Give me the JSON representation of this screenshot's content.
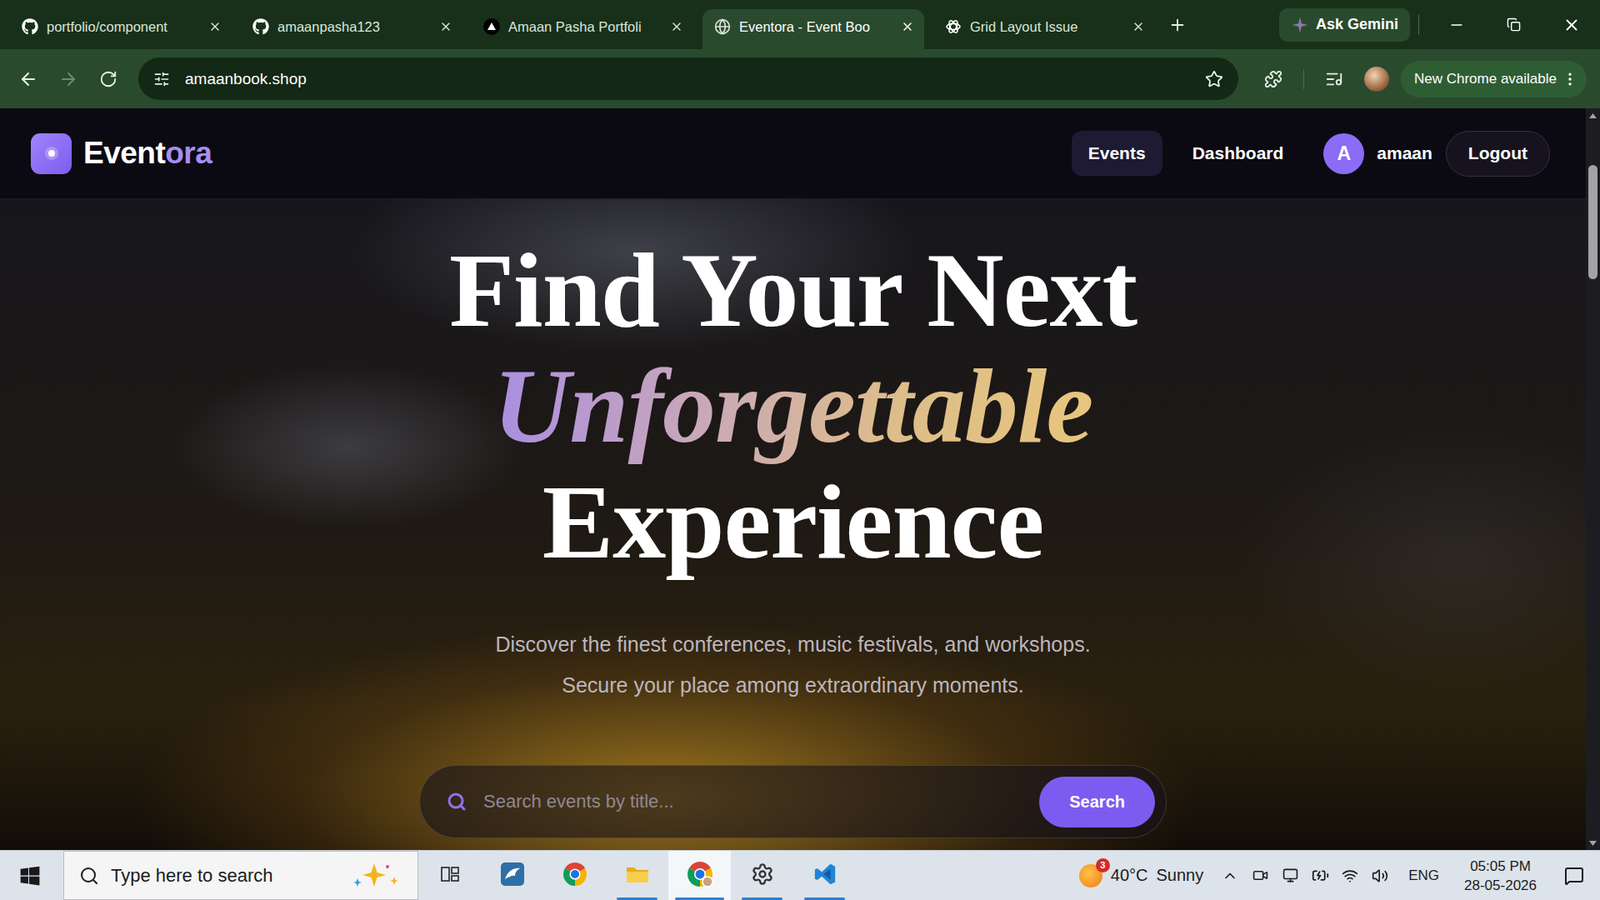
{
  "browser": {
    "tabs": [
      {
        "label": "portfolio/component",
        "selected": false
      },
      {
        "label": "amaanpasha123",
        "selected": false
      },
      {
        "label": "Amaan Pasha Portfoli",
        "selected": false
      },
      {
        "label": "Eventora - Event Boo",
        "selected": true
      },
      {
        "label": "Grid Layout Issue",
        "selected": false
      }
    ],
    "gemini_button": "Ask Gemini",
    "toolbar": {
      "back_disabled": false,
      "forward_disabled": true,
      "address": "amaanbook.shop",
      "bookmarked": false,
      "update_button": "New Chrome available"
    }
  },
  "page": {
    "navbar": {
      "logo": {
        "main": "Event",
        "accent": "ora"
      },
      "links": [
        {
          "label": "Events",
          "selected": true
        },
        {
          "label": "Dashboard",
          "selected": false
        }
      ],
      "user": {
        "initial": "A",
        "name": "amaan"
      },
      "logout": "Logout"
    },
    "hero": {
      "title": {
        "before": "Find Your Next",
        "accent": "Unforgettable",
        "after": "Experience"
      },
      "subtitle": [
        "Discover the finest conferences, music festivals, and workshops.",
        "Secure your place among extraordinary moments."
      ],
      "search": {
        "placeholder": "Search events by title...",
        "button": "Search"
      }
    },
    "scrollbar": {
      "level": 0.16,
      "position": 0.06
    }
  },
  "taskbar": {
    "search_placeholder": "Type here to search",
    "apps": [
      {
        "running": false,
        "selected": false
      },
      {
        "running": false,
        "selected": false
      },
      {
        "running": false,
        "selected": false
      },
      {
        "running": true,
        "selected": false
      },
      {
        "running": true,
        "selected": true
      },
      {
        "running": true,
        "selected": false
      },
      {
        "running": true,
        "selected": false
      }
    ],
    "weather": {
      "badge": "3",
      "temperature": "40°C",
      "condition": "Sunny"
    },
    "language": "ENG",
    "time": "05:05 PM",
    "date": "28-05-2026"
  }
}
